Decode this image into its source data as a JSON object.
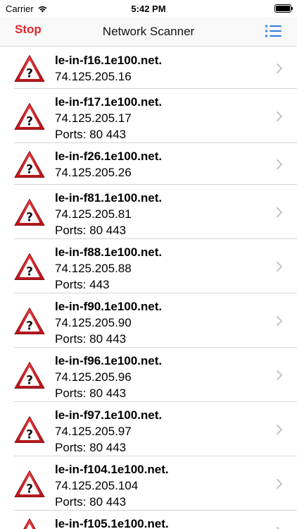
{
  "status": {
    "carrier": "Carrier",
    "time": "5:42 PM"
  },
  "nav": {
    "title": "Network Scanner",
    "stop_label": "Stop"
  },
  "rows": [
    {
      "host": "le-in-f16.1e100.net.",
      "ip": "74.125.205.16",
      "ports": ""
    },
    {
      "host": "le-in-f17.1e100.net.",
      "ip": "74.125.205.17",
      "ports": "Ports: 80 443"
    },
    {
      "host": "le-in-f26.1e100.net.",
      "ip": "74.125.205.26",
      "ports": ""
    },
    {
      "host": "le-in-f81.1e100.net.",
      "ip": "74.125.205.81",
      "ports": "Ports: 80 443"
    },
    {
      "host": "le-in-f88.1e100.net.",
      "ip": "74.125.205.88",
      "ports": "Ports: 443"
    },
    {
      "host": "le-in-f90.1e100.net.",
      "ip": "74.125.205.90",
      "ports": "Ports: 80 443"
    },
    {
      "host": "le-in-f96.1e100.net.",
      "ip": "74.125.205.96",
      "ports": "Ports: 80 443"
    },
    {
      "host": "le-in-f97.1e100.net.",
      "ip": "74.125.205.97",
      "ports": "Ports: 80 443"
    },
    {
      "host": "le-in-f104.1e100.net.",
      "ip": "74.125.205.104",
      "ports": "Ports: 80 443"
    },
    {
      "host": "le-in-f105.1e100.net.",
      "ip": "",
      "ports": ""
    }
  ],
  "colors": {
    "accent": "#e0262a",
    "list_icon": "#2f7de1",
    "warn_red": "#d3232c"
  },
  "icons": {
    "row": "warning-icon",
    "disclosure": "chevron-right-icon",
    "menu": "list-icon"
  }
}
